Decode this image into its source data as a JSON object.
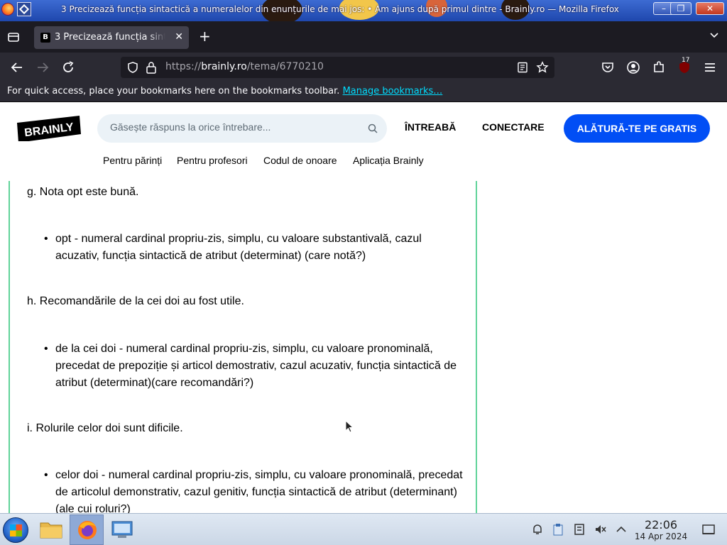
{
  "window": {
    "title": "3 Precizează funcția sintactică a numeralelor din enunțurile de mai jos: • Am ajuns după primul dintre - Brainly.ro — Mozilla Firefox",
    "controls": [
      "minimize",
      "maximize",
      "close"
    ]
  },
  "tabs": [
    {
      "label": "3 Precizează funcția sintactică",
      "favicon": "B",
      "active": true
    }
  ],
  "browser": {
    "url_prefix": "https://",
    "url_host": "brainly.ro",
    "url_path": "/tema/6770210",
    "extension_badge": "17",
    "bookmarks_message": "For quick access, place your bookmarks here on the bookmarks toolbar.",
    "bookmarks_link": "Manage bookmarks…"
  },
  "site": {
    "logo_text": "BRAINLY",
    "search_placeholder": "Găsește răspuns la orice întrebare...",
    "ask_label": "ÎNTREABĂ",
    "login_label": "CONECTARE",
    "join_label": "ALĂTURĂ-TE PE GRATIS",
    "subnav": [
      "Pentru părinți",
      "Pentru profesori",
      "Codul de onoare",
      "Aplicația Brainly"
    ],
    "brand_color": "#014ef5",
    "answer_border_color": "#60d399"
  },
  "answer": {
    "items": [
      {
        "sentence": "g. Nota opt este bună.",
        "explanation": "opt - numeral cardinal propriu-zis, simplu, cu valoare substantivală, cazul acuzativ, funcția sintactică de atribut (determinat) (care notă?)"
      },
      {
        "sentence": "h. Recomandările de la cei doi au fost utile.",
        "explanation": "de la cei doi - numeral cardinal propriu-zis, simplu, cu valoare pronominală, precedat de prepoziție și articol demostrativ, cazul acuzativ, funcția sintactică de atribut (determinat)(care recomandări?)"
      },
      {
        "sentence": "i. Rolurile celor doi sunt dificile.",
        "explanation": "celor doi - numeral cardinal propriu-zis, simplu, cu valoare pronominală, precedat de articolul demonstrativ, cazul genitiv, funcția sintactică de atribut (determinant) (ale cui roluri?)"
      }
    ]
  },
  "taskbar": {
    "time": "22:06",
    "date": "14 Apr 2024",
    "apps": [
      "start-menu",
      "file-manager",
      "firefox",
      "control-panel"
    ],
    "tray": [
      "notification-bell-icon",
      "clipboard-icon",
      "removable-drive-icon",
      "volume-muted-icon",
      "tray-expand-icon"
    ]
  }
}
